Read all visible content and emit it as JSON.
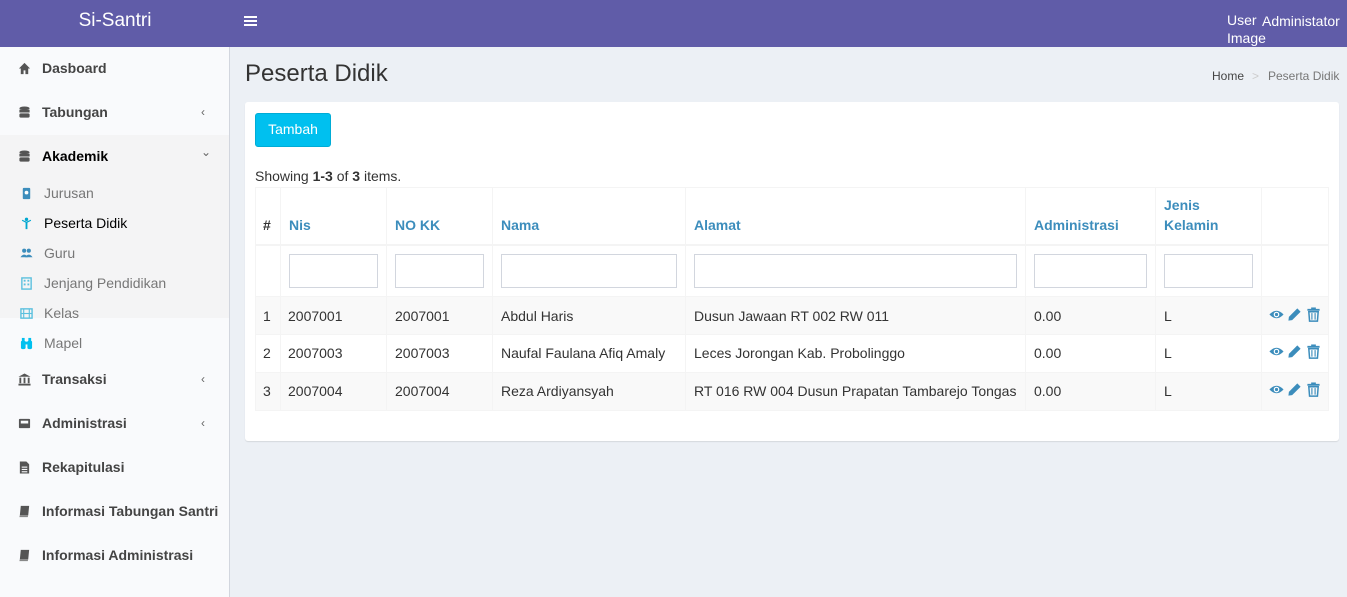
{
  "header": {
    "app_name": "Si-Santri",
    "user_image_alt": "User Image",
    "user_name": "Administator",
    "color": "#605ca8"
  },
  "sidebar": {
    "items": [
      {
        "label": "Dasboard",
        "icon": "home-icon"
      },
      {
        "label": "Tabungan",
        "icon": "database-icon",
        "chevron": "‹"
      },
      {
        "label": "Akademik",
        "icon": "database-icon",
        "chevron": "⌄"
      },
      {
        "label": "Transaksi",
        "icon": "bank-icon",
        "chevron": "‹"
      },
      {
        "label": "Administrasi",
        "icon": "inbox-icon",
        "chevron": "‹"
      },
      {
        "label": "Rekapitulasi",
        "icon": "file-icon"
      },
      {
        "label": "Informasi Tabungan Santri",
        "icon": "book-icon"
      },
      {
        "label": "Informasi Administrasi",
        "icon": "book-icon"
      }
    ],
    "sub_items": [
      {
        "label": "Jurusan",
        "icon": "id-badge-icon"
      },
      {
        "label": "Peserta Didik",
        "icon": "child-icon"
      },
      {
        "label": "Guru",
        "icon": "users-icon"
      },
      {
        "label": "Jenjang Pendidikan",
        "icon": "building-icon"
      },
      {
        "label": "Kelas",
        "icon": "film-icon"
      },
      {
        "label": "Mapel",
        "icon": "binoculars-icon"
      }
    ]
  },
  "page": {
    "title": "Peserta Didik",
    "breadcrumb": {
      "home": "Home",
      "separator": ">",
      "current": "Peserta Didik"
    },
    "add_button": "Tambah",
    "summary": {
      "prefix": "Showing ",
      "range": "1-3",
      "of": " of ",
      "total": "3",
      "suffix": " items."
    }
  },
  "table": {
    "headers": {
      "num": "#",
      "nis": "Nis",
      "no_kk": "NO KK",
      "nama": "Nama",
      "alamat": "Alamat",
      "administrasi": "Administrasi",
      "jenis_kelamin_1": "Jenis",
      "jenis_kelamin_2": "Kelamin"
    },
    "rows": [
      {
        "num": "1",
        "nis": "2007001",
        "no_kk": "2007001",
        "nama": "Abdul Haris",
        "alamat": "Dusun Jawaan RT 002 RW 011",
        "administrasi": "0.00",
        "jk": "L"
      },
      {
        "num": "2",
        "nis": "2007003",
        "no_kk": "2007003",
        "nama": "Naufal Faulana Afiq Amaly",
        "alamat": "Leces Jorongan Kab. Probolinggo",
        "administrasi": "0.00",
        "jk": "L"
      },
      {
        "num": "3",
        "nis": "2007004",
        "no_kk": "2007004",
        "nama": "Reza Ardiyansyah",
        "alamat": "RT 016 RW 004 Dusun Prapatan Tambarejo Tongas",
        "administrasi": "0.00",
        "jk": "L"
      }
    ],
    "accent": "#3c8dbc"
  }
}
